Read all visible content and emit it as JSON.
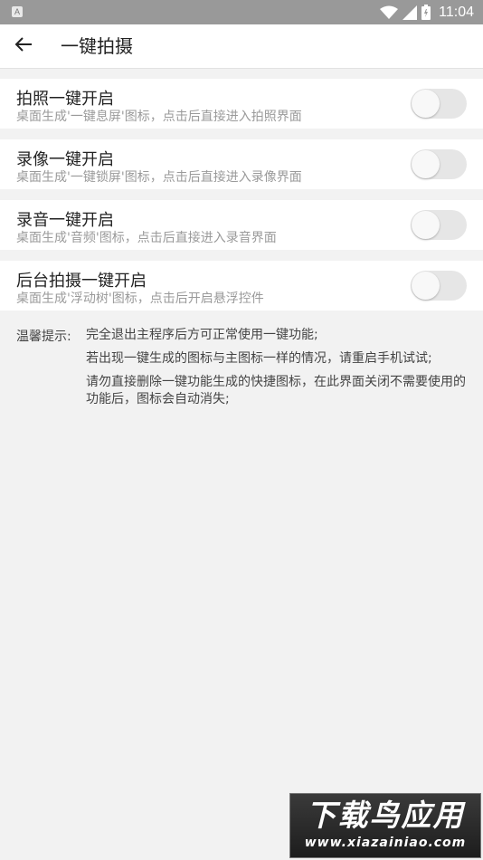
{
  "status_bar": {
    "left_icon": "A",
    "time": "11:04",
    "icons": [
      "wifi-icon",
      "cell-signal-icon",
      "battery-icon"
    ]
  },
  "app_bar": {
    "back_icon": "arrow-left-icon",
    "title": "一键拍摄"
  },
  "settings": [
    {
      "title": "拍照一键开启",
      "desc": "桌面生成'一键息屏'图标，点击后直接进入拍照界面",
      "enabled": false
    },
    {
      "title": "录像一键开启",
      "desc": "桌面生成'一键锁屏'图标，点击后直接进入录像界面",
      "enabled": false
    },
    {
      "title": "录音一键开启",
      "desc": "桌面生成'音频'图标，点击后直接进入录音界面",
      "enabled": false
    },
    {
      "title": "后台拍摄一键开启",
      "desc": "桌面生成'浮动树'图标，点击后开启悬浮控件",
      "enabled": false
    }
  ],
  "tips": {
    "label": "温馨提示:",
    "lines": [
      "完全退出主程序后方可正常使用一键功能;",
      "若出现一键生成的图标与主图标一样的情况，请重启手机试试;",
      "请勿直接删除一键功能生成的快捷图标，在此界面关闭不需要使用的功能后，图标会自动消失;"
    ]
  },
  "watermark": {
    "title": "下载鸟应用",
    "url": "www.xiazainiao.com"
  },
  "colors": {
    "status_bar": "#999999",
    "background": "#f2f2f2",
    "toggle_track_off": "#e6e6e6"
  }
}
